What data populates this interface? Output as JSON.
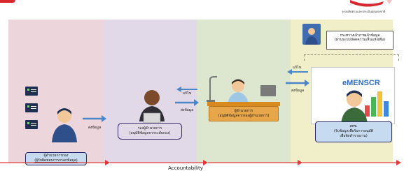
{
  "logo": {
    "subtitle": "ระบบติดตามและประเมินผลแห่งชาติ"
  },
  "stages": [
    {
      "role": "ผู้อำนวยการกอง",
      "action": "(ผู้รับผิดชอบการกรอกข้อมูล)",
      "arrow_label": "ส่งข้อมูล"
    },
    {
      "role": "รองผู้อำนวยการ",
      "action": "(อนุมัติข้อมูลจากระดับกอง)",
      "return_label": "แก้ไข",
      "forward_label": "ส่งข้อมูล"
    },
    {
      "role": "ผู้อำนวยการ",
      "action": "(อนุมัติข้อมูลจากรองผู้อำนวยการ)",
      "return_label": "แก้ไข",
      "forward_label": "ส่งข้อมูล"
    },
    {
      "ministry_line1": "กระทรวงเจ้าภาพเจ้าข้อมูล",
      "ministry_line2": "(ผ่านระบบปลดความเห็นแห่งเพิ่ม)",
      "system_name": "eMENSCR",
      "org": "สศช.",
      "org_line1": "(รับข้อมูลเพื่อรับการอนุมัติ",
      "org_line2": "เพื่อจัดทำรายงาน)"
    }
  ],
  "footer": {
    "label": "Accountability"
  },
  "colors": {
    "stage1": "#ecd6db",
    "stage2": "#e1d9e8",
    "stage3": "#dde7d0",
    "stage4": "#f0efc9",
    "arrow": "#4a86c8",
    "accountability": "#e03a3a",
    "role_box": "#c7dbf0"
  }
}
